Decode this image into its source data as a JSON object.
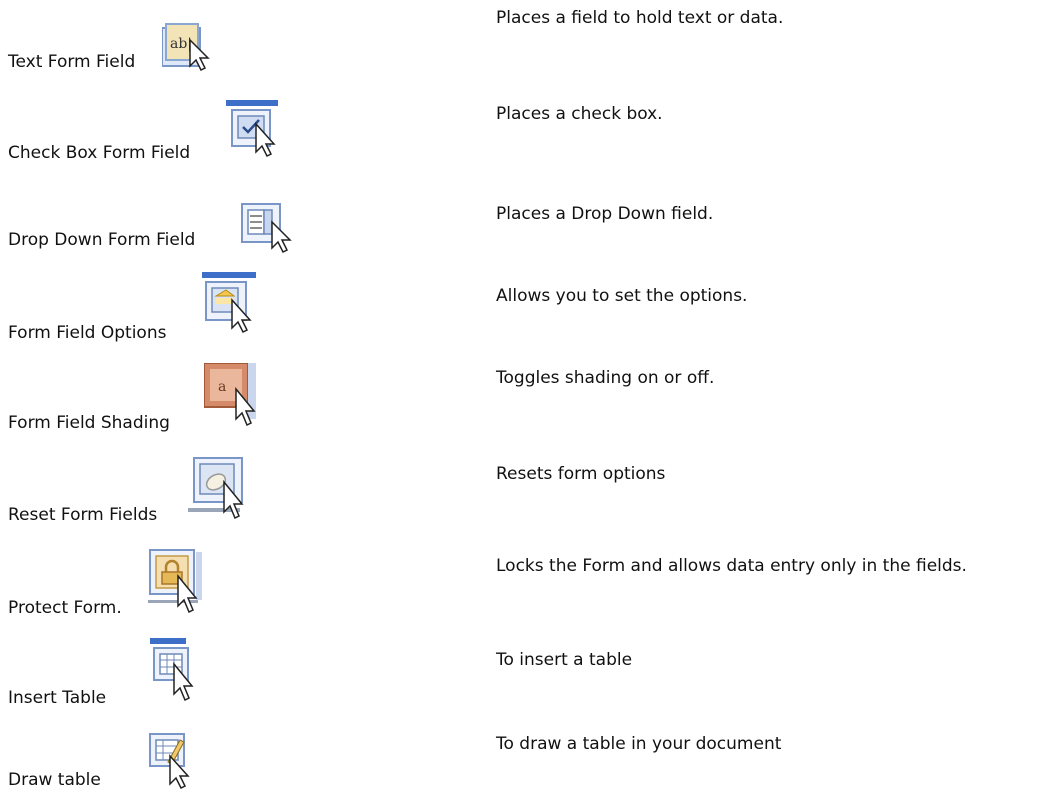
{
  "items": [
    {
      "name": "Text Form Field",
      "desc": "Places a field to hold text or data.",
      "icon": "text-form-field-icon"
    },
    {
      "name": "Check Box Form Field",
      "desc": "Places a check box.",
      "icon": "check-box-form-field-icon"
    },
    {
      "name": "Drop Down Form Field",
      "desc": "Places a Drop Down field.",
      "icon": "drop-down-form-field-icon"
    },
    {
      "name": "Form Field Options",
      "desc": "Allows you to set the options.",
      "icon": "form-field-options-icon"
    },
    {
      "name": "Form Field Shading",
      "desc": "Toggles shading on or off.",
      "icon": "form-field-shading-icon"
    },
    {
      "name": "Reset Form Fields",
      "desc": "Resets form options",
      "icon": "reset-form-fields-icon"
    },
    {
      "name": "Protect Form.",
      "desc": "Locks the Form and allows data entry only in the fields.",
      "icon": "protect-form-icon"
    },
    {
      "name": "Insert Table",
      "desc": "To insert a table",
      "icon": "insert-table-icon"
    },
    {
      "name": "Draw table",
      "desc": "To draw a table in your document",
      "icon": "draw-table-icon"
    }
  ],
  "icon_glyphs": {
    "text_form_field": "ab|"
  }
}
